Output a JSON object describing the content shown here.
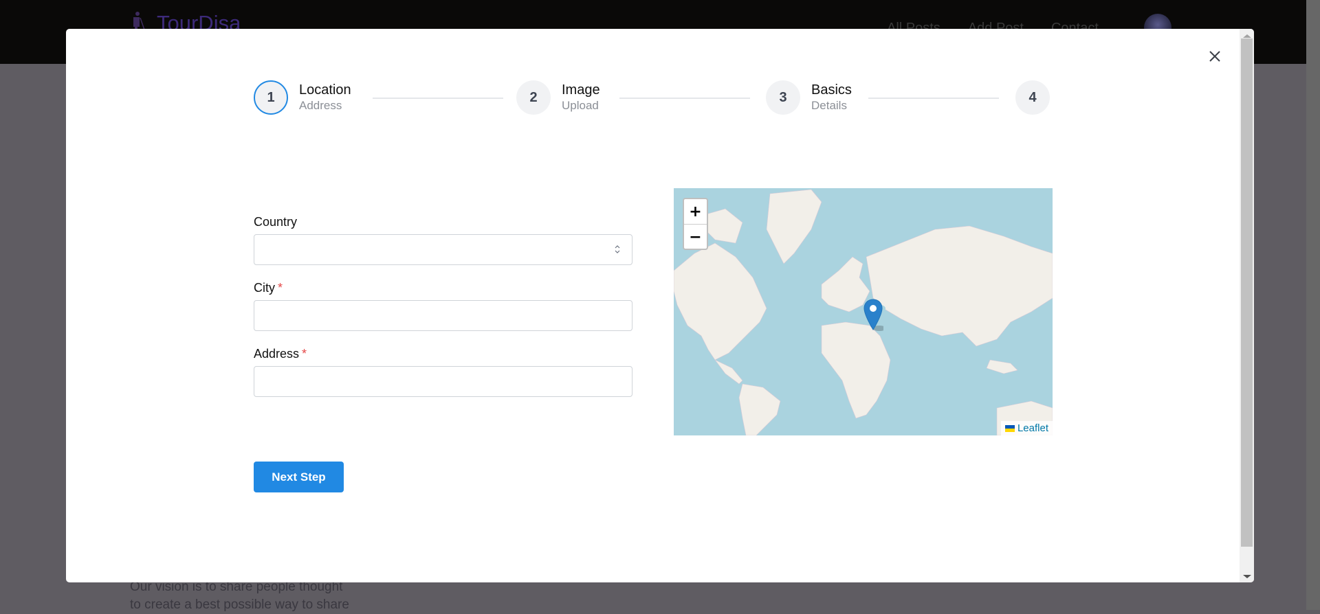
{
  "background": {
    "brand": "TourDisa",
    "nav": [
      "All Posts",
      "Add Post",
      "Contact"
    ],
    "body_text_line1": "Our vision is to share people thought",
    "body_text_line2": "to create a best possible way to share"
  },
  "stepper": {
    "steps": [
      {
        "number": "1",
        "title": "Location",
        "subtitle": "Address",
        "active": true
      },
      {
        "number": "2",
        "title": "Image",
        "subtitle": "Upload",
        "active": false
      },
      {
        "number": "3",
        "title": "Basics",
        "subtitle": "Details",
        "active": false
      },
      {
        "number": "4",
        "title": "",
        "subtitle": "",
        "active": false
      }
    ]
  },
  "form": {
    "country": {
      "label": "Country",
      "value": "",
      "required": false
    },
    "city": {
      "label": "City",
      "value": "",
      "required": true
    },
    "address": {
      "label": "Address",
      "value": "",
      "required": true
    },
    "required_mark": "*"
  },
  "map": {
    "zoom_in": "+",
    "zoom_out": "−",
    "attribution": "Leaflet",
    "marker_location": "Black Sea / Romania region"
  },
  "buttons": {
    "next_step": "Next Step",
    "close": "×"
  },
  "colors": {
    "accent": "#2189e3",
    "required": "#e54848",
    "map_water": "#aad3df",
    "map_land": "#f2efe9"
  }
}
